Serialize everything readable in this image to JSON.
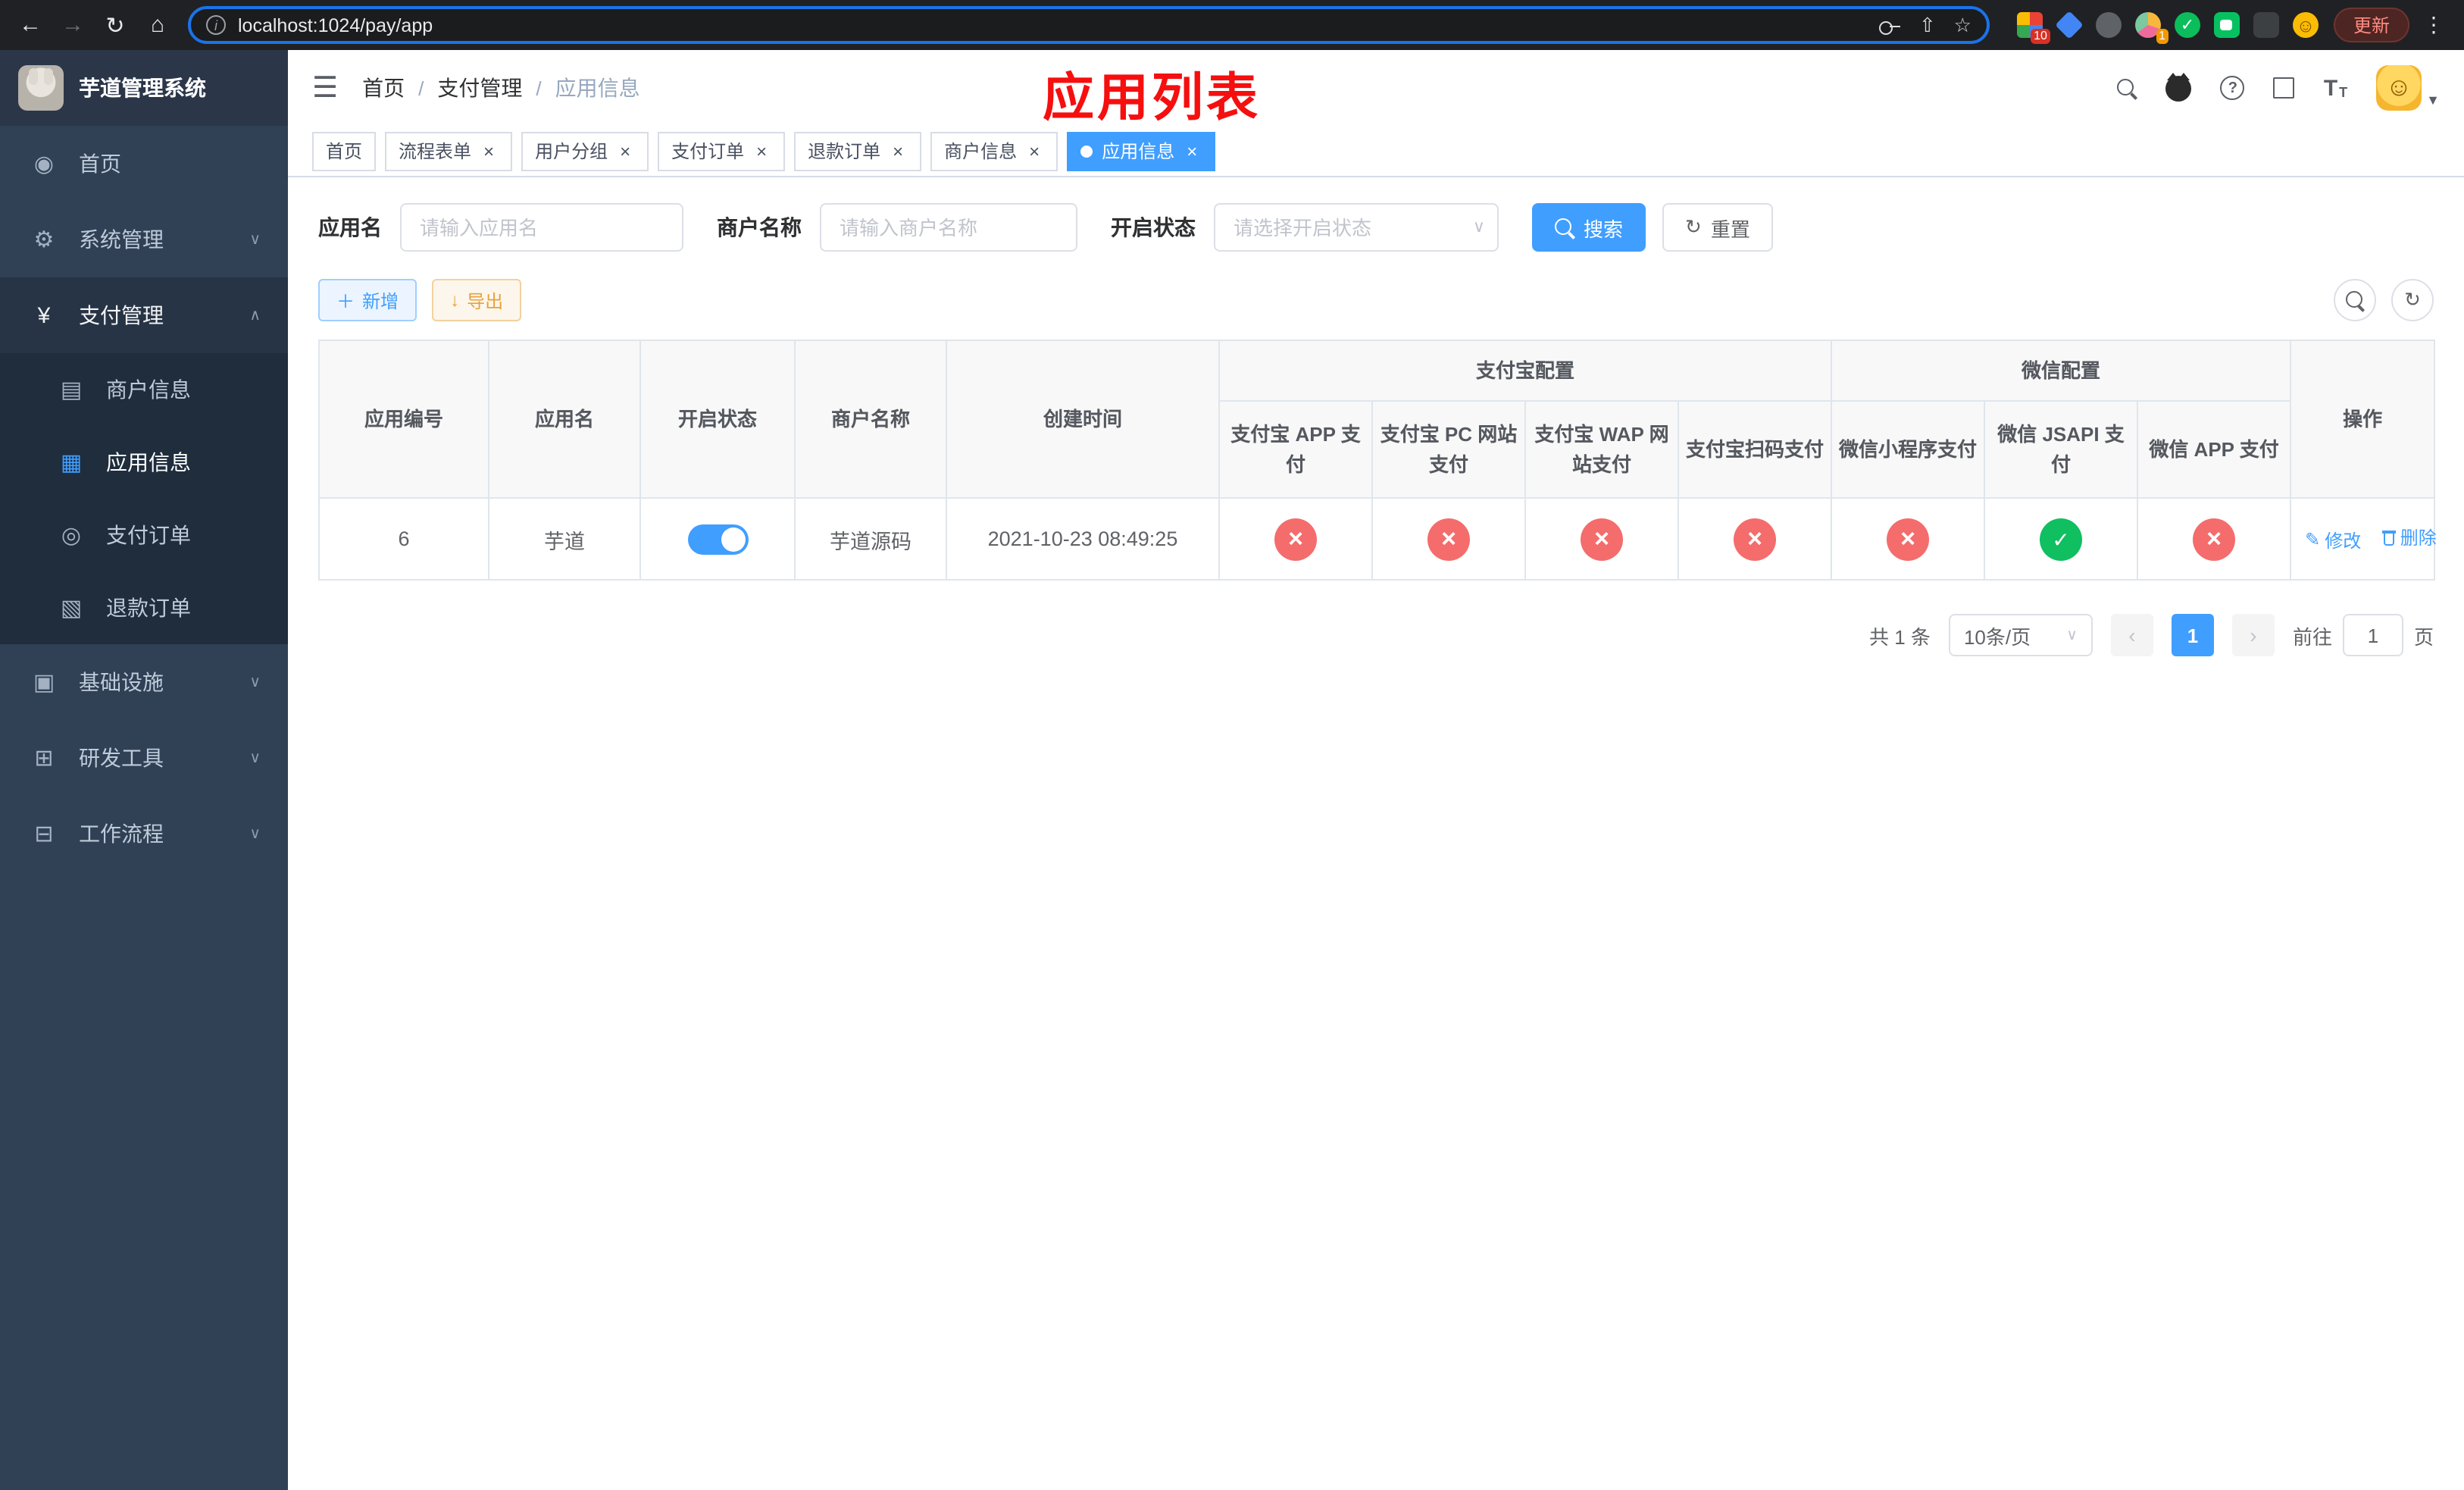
{
  "colors": {
    "accent": "#409eff",
    "danger": "#f56c6c",
    "success": "#0fbf60",
    "sidebar_bg": "#304156",
    "annotation_red": "#f50f0f"
  },
  "browser": {
    "url": "localhost:1024/pay/app",
    "update_label": "更新",
    "ext_badges": [
      "10",
      "1"
    ]
  },
  "sidebar": {
    "title": "芋道管理系统",
    "items": [
      {
        "label": "首页"
      },
      {
        "label": "系统管理"
      },
      {
        "label": "支付管理"
      },
      {
        "label": "基础设施"
      },
      {
        "label": "研发工具"
      },
      {
        "label": "工作流程"
      }
    ],
    "payment_children": [
      {
        "label": "商户信息"
      },
      {
        "label": "应用信息"
      },
      {
        "label": "支付订单"
      },
      {
        "label": "退款订单"
      }
    ]
  },
  "header": {
    "breadcrumb": [
      "首页",
      "支付管理",
      "应用信息"
    ],
    "annotation": "应用列表"
  },
  "tabs": [
    {
      "label": "首页"
    },
    {
      "label": "流程表单"
    },
    {
      "label": "用户分组"
    },
    {
      "label": "支付订单"
    },
    {
      "label": "退款订单"
    },
    {
      "label": "商户信息"
    },
    {
      "label": "应用信息"
    }
  ],
  "filters": {
    "app_name": {
      "label": "应用名",
      "placeholder": "请输入应用名"
    },
    "merchant_name": {
      "label": "商户名称",
      "placeholder": "请输入商户名称"
    },
    "status": {
      "label": "开启状态",
      "placeholder": "请选择开启状态"
    },
    "search_label": "搜索",
    "reset_label": "重置"
  },
  "toolbar": {
    "add_label": "新增",
    "export_label": "导出"
  },
  "table": {
    "headers": {
      "app_id": "应用编号",
      "app_name": "应用名",
      "status": "开启状态",
      "merchant": "商户名称",
      "created": "创建时间",
      "alipay_group": "支付宝配置",
      "alipay": [
        "支付宝 APP 支付",
        "支付宝 PC 网站支付",
        "支付宝 WAP 网站支付",
        "支付宝扫码支付"
      ],
      "wechat_group": "微信配置",
      "wechat": [
        "微信小程序支付",
        "微信 JSAPI 支付",
        "微信 APP 支付"
      ],
      "actions": "操作"
    },
    "rows": [
      {
        "app_id": "6",
        "app_name": "芋道",
        "status_on": "true",
        "merchant": "芋道源码",
        "created": "2021-10-23 08:49:25",
        "pay_status": [
          "disabled",
          "disabled",
          "disabled",
          "disabled",
          "disabled",
          "enabled",
          "disabled"
        ],
        "edit_label": "修改",
        "delete_label": "删除"
      }
    ]
  },
  "pagination": {
    "total": "共 1 条",
    "page_size": "10条/页",
    "current_page": "1",
    "goto_label": "前往",
    "goto_value": "1",
    "page_suffix": "页"
  }
}
